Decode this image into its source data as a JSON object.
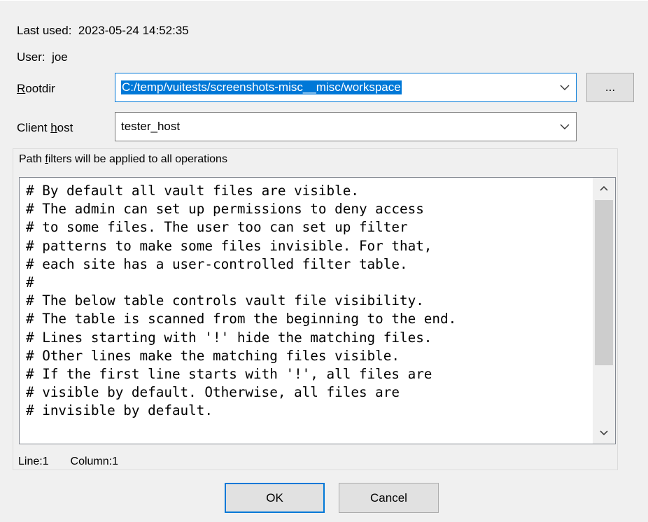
{
  "dialog": {
    "last_used_label": "Last used:",
    "last_used_value": "2023-05-24 14:52:35",
    "user_label": "User:",
    "user_value": "joe",
    "rootdir_label_first": "R",
    "rootdir_label_rest": "ootdir",
    "rootdir_value": "C:/temp/vuitests/screenshots-misc__misc/workspace",
    "browse_label": "...",
    "client_host_label_pre": "Client ",
    "client_host_label_u": "h",
    "client_host_label_post": "ost",
    "client_host_value": "tester_host",
    "path_filters_pre": "Path ",
    "path_filters_u": "f",
    "path_filters_post": "ilters will be applied to all operations",
    "editor_lines": [
      "# By default all vault files are visible.",
      "# The admin can set up permissions to deny access",
      "# to some files. The user too can set up filter",
      "# patterns to make some files invisible. For that,",
      "# each site has a user-controlled filter table.",
      "#",
      "# The below table controls vault file visibility.",
      "# The table is scanned from the beginning to the end.",
      "# Lines starting with '!' hide the matching files.",
      "# Other lines make the matching files visible.",
      "# If the first line starts with '!', all files are",
      "# visible by default. Otherwise, all files are",
      "# invisible by default."
    ],
    "status_line_label": "Line:",
    "status_line_value": "1",
    "status_column_label": "Column:",
    "status_column_value": "1",
    "ok_label": "OK",
    "cancel_label": "Cancel"
  },
  "colors": {
    "selection": "#0078d7",
    "background": "#f0f0f0"
  }
}
